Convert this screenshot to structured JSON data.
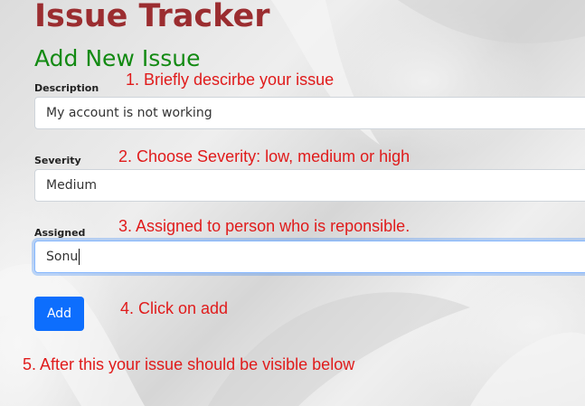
{
  "header": {
    "app_title": "Issue Tracker",
    "section_title": "Add New Issue"
  },
  "form": {
    "description": {
      "label": "Description",
      "value": "My account is not working"
    },
    "severity": {
      "label": "Severity",
      "value": "Medium"
    },
    "assigned": {
      "label": "Assigned",
      "value": "Sonu"
    },
    "add_button_label": "Add"
  },
  "annotations": {
    "step1": "1. Briefly descirbe your issue",
    "step2": "2. Choose Severity: low, medium or high",
    "step3": "3. Assigned to person who is reponsible.",
    "step4": "4. Click on add",
    "step5": "5. After this your issue should be visible below"
  },
  "colors": {
    "title": "#9b2d30",
    "section_title": "#138a13",
    "annotation": "#e01b1b",
    "button": "#0d6efd"
  }
}
